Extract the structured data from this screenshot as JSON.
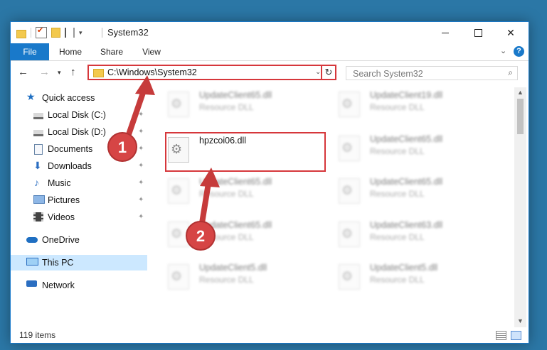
{
  "window": {
    "title": "System32",
    "controls": {
      "minimize": "minimize-icon",
      "maximize": "maximize-icon",
      "close": "close-icon"
    }
  },
  "ribbon": {
    "tabs": [
      "File",
      "Home",
      "Share",
      "View"
    ],
    "help": "?"
  },
  "navbar": {
    "address": "C:\\Windows\\System32",
    "search_placeholder": "Search System32"
  },
  "sidebar": {
    "items": [
      {
        "label": "Quick access",
        "icon": "star-icon"
      },
      {
        "label": "Local Disk (C:)",
        "icon": "disk-icon",
        "pinned": true
      },
      {
        "label": "Local Disk (D:)",
        "icon": "disk-icon",
        "pinned": true
      },
      {
        "label": "Documents",
        "icon": "documents-icon",
        "pinned": true
      },
      {
        "label": "Downloads",
        "icon": "downloads-icon",
        "pinned": true
      },
      {
        "label": "Music",
        "icon": "music-icon",
        "pinned": true
      },
      {
        "label": "Pictures",
        "icon": "pictures-icon",
        "pinned": true
      },
      {
        "label": "Videos",
        "icon": "videos-icon",
        "pinned": true
      },
      {
        "label": "OneDrive",
        "icon": "onedrive-icon"
      },
      {
        "label": "This PC",
        "icon": "this-pc-icon",
        "selected": true
      },
      {
        "label": "Network",
        "icon": "network-icon"
      }
    ]
  },
  "files": {
    "highlighted": {
      "name": "hpzcoi06.dll",
      "type": ""
    },
    "left_column": [
      {
        "name": "UpdateClient65.dll",
        "type": "Resource DLL"
      },
      {
        "name": "UpdateClient65.dll",
        "type": "Resource DLL"
      },
      {
        "name": "UpdateClient65.dll",
        "type": "Resource DLL"
      },
      {
        "name": "UpdateClient5.dll",
        "type": "Resource DLL"
      }
    ],
    "right_column": [
      {
        "name": "UpdateClient19.dll",
        "type": "Resource DLL"
      },
      {
        "name": "UpdateClient65.dll",
        "type": "Resource DLL"
      },
      {
        "name": "UpdateClient65.dll",
        "type": "Resource DLL"
      },
      {
        "name": "UpdateClient63.dll",
        "type": "Resource DLL"
      },
      {
        "name": "UpdateClient5.dll",
        "type": "Resource DLL"
      }
    ]
  },
  "status": {
    "item_count": "119 items"
  },
  "annotations": {
    "step1": "1",
    "step2": "2",
    "color": "#e04a4a"
  }
}
